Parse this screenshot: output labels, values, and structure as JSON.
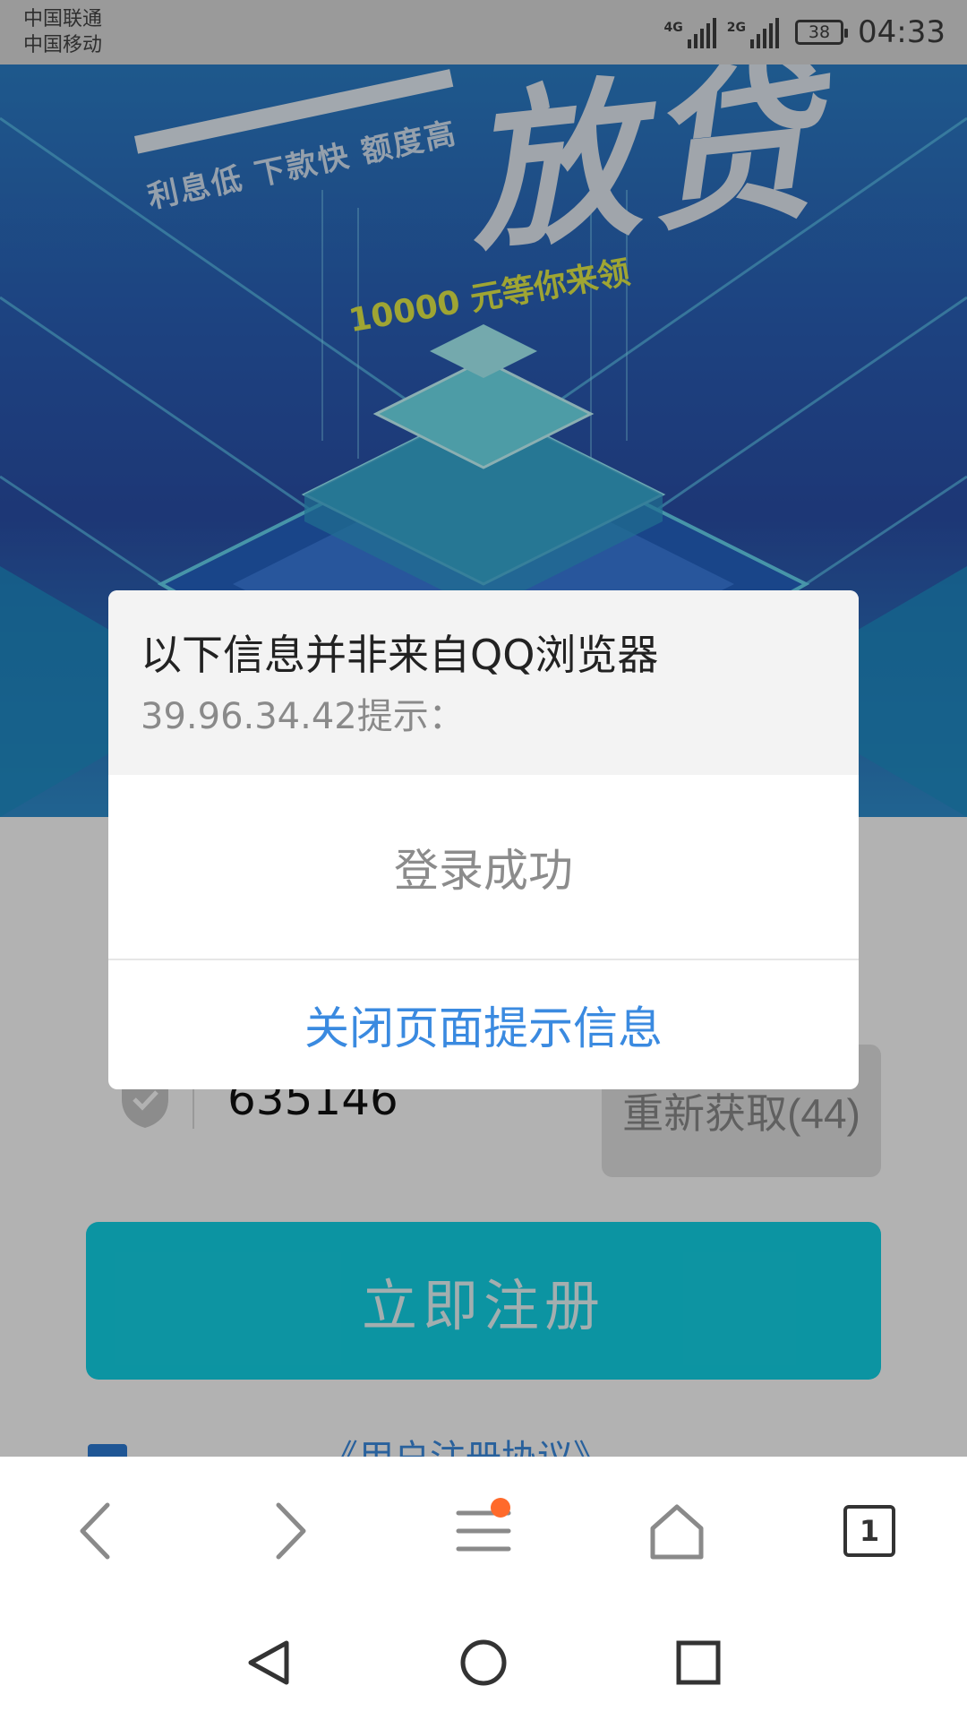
{
  "status_bar": {
    "carrier_1": "中国联通",
    "carrier_2": "中国移动",
    "network_1": "4G",
    "network_2": "2G",
    "battery": "38",
    "time": "04:33"
  },
  "banner": {
    "tagline": "利息低 下款快 额度高",
    "promo": "10000 元等你来领",
    "headline_glyph": "放贷"
  },
  "form": {
    "verification_code": "635146",
    "resend_label": "重新获取(44)",
    "register_label": "立即注册",
    "agreement_link": "《用户注册协议》"
  },
  "dialog": {
    "title": "以下信息并非来自QQ浏览器",
    "source": "39.96.34.42提示：",
    "message": "登录成功",
    "close_label": "关闭页面提示信息"
  },
  "browser_toolbar": {
    "tab_count": "1",
    "icons": [
      "back-icon",
      "forward-icon",
      "menu-icon",
      "home-icon",
      "tabs-icon"
    ],
    "menu_badge_color": "#ff6a2b"
  },
  "nav_bar": {
    "icons": [
      "nav-back-icon",
      "nav-home-icon",
      "nav-recents-icon"
    ]
  },
  "colors": {
    "accent_button": "#12d4e8",
    "link_blue": "#3a8ae0",
    "status_bar_bg": "#9a9a9a"
  }
}
